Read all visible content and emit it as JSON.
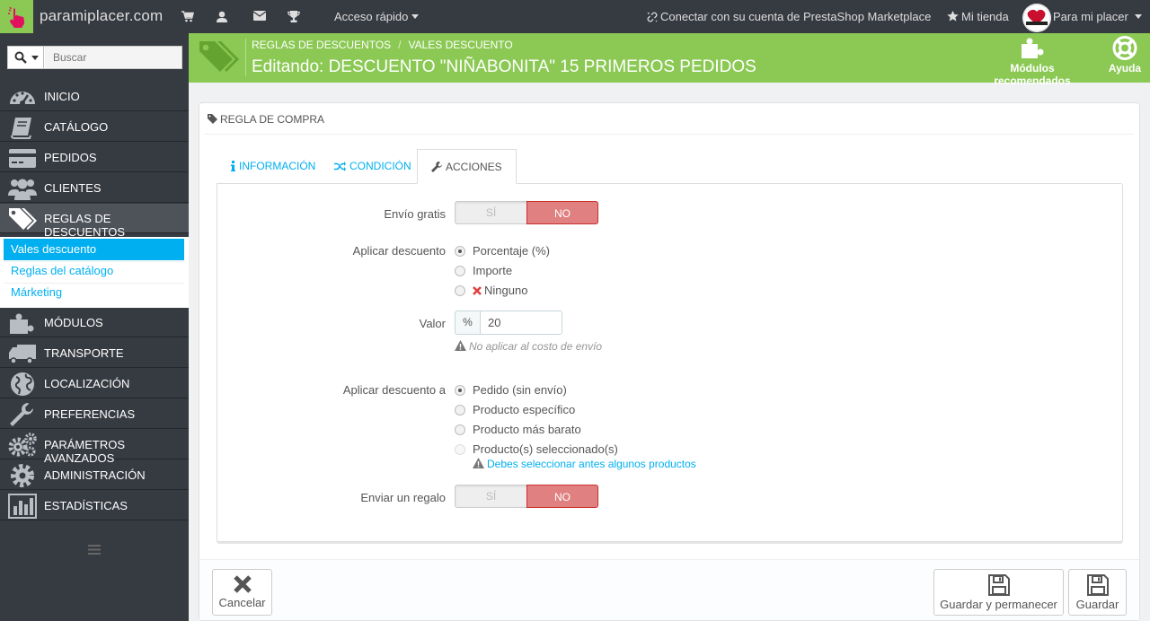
{
  "topbar": {
    "shop_name": "paramiplacer.com",
    "quick_access": "Acceso rápido",
    "connect": "Conectar con su cuenta de PrestaShop Marketplace",
    "my_store": "Mi tienda",
    "user": "Para mi placer"
  },
  "sidebar": {
    "search_placeholder": "Buscar",
    "items": [
      {
        "label": "INICIO",
        "icon": "dashboard-icon"
      },
      {
        "label": "CATÁLOGO",
        "icon": "book-icon"
      },
      {
        "label": "PEDIDOS",
        "icon": "credit-card-icon"
      },
      {
        "label": "CLIENTES",
        "icon": "users-icon"
      },
      {
        "label": "REGLAS DE DESCUENTOS",
        "icon": "tag-icon"
      },
      {
        "label": "MÓDULOS",
        "icon": "puzzle-icon"
      },
      {
        "label": "TRANSPORTE",
        "icon": "truck-icon"
      },
      {
        "label": "LOCALIZACIÓN",
        "icon": "globe-icon"
      },
      {
        "label": "PREFERENCIAS",
        "icon": "wrench-icon"
      },
      {
        "label": "PARÁMETROS AVANZADOS",
        "icon": "cogs-icon"
      },
      {
        "label": "ADMINISTRACIÓN",
        "icon": "cog-icon"
      },
      {
        "label": "ESTADÍSTICAS",
        "icon": "bar-chart-icon"
      }
    ],
    "submenu": [
      "Vales descuento",
      "Reglas del catálogo",
      "Márketing"
    ]
  },
  "header": {
    "breadcrumb": [
      "REGLAS DE DESCUENTOS",
      "VALES DESCUENTO"
    ],
    "title": "Editando: DESCUENTO \"NIÑABONITA\" 15 PRIMEROS PEDIDOS",
    "modules_button": "Módulos recomendados",
    "help_button": "Ayuda",
    "accent_color": "#8bc954"
  },
  "panel": {
    "title": "REGLA DE COMPRA",
    "tabs": [
      "INFORMACIÓN",
      "CONDICIÓN",
      "ACCIONES"
    ],
    "active_tab": "ACCIONES",
    "free_shipping": {
      "label": "Envío gratis",
      "yes": "SÍ",
      "no": "NO",
      "value": "NO"
    },
    "apply_discount": {
      "label": "Aplicar descuento",
      "options": [
        "Porcentaje (%)",
        "Importe",
        "Ninguno"
      ],
      "selected": "Porcentaje (%)"
    },
    "value": {
      "label": "Valor",
      "addon": "%",
      "value": "20",
      "help": "No aplicar al costo de envío"
    },
    "apply_to": {
      "label": "Aplicar descuento a",
      "options": [
        "Pedido (sin envío)",
        "Producto específico",
        "Producto más barato",
        "Producto(s) seleccionado(s)"
      ],
      "selected": "Pedido (sin envío)",
      "warning": "Debes seleccionar antes algunos productos"
    },
    "gift": {
      "label": "Enviar un regalo",
      "yes": "SÍ",
      "no": "NO",
      "value": "NO"
    }
  },
  "footer": {
    "cancel": "Cancelar",
    "save_stay": "Guardar y permanecer",
    "save": "Guardar"
  }
}
